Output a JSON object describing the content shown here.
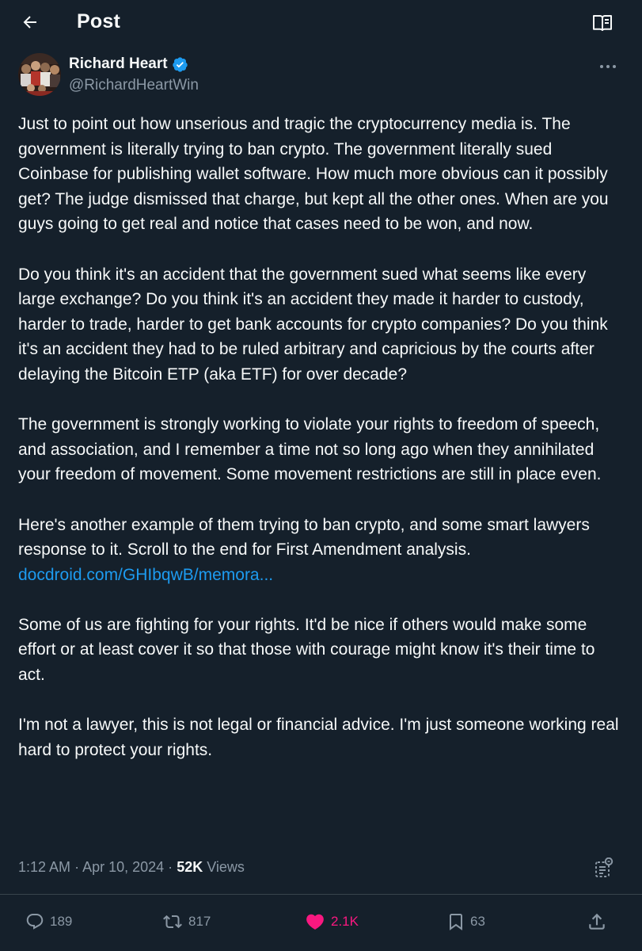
{
  "header": {
    "title": "Post"
  },
  "author": {
    "name": "Richard Heart",
    "handle": "@RichardHeartWin",
    "verified": true
  },
  "tweet": {
    "paragraphs": [
      "Just to point out how unserious and tragic the cryptocurrency media is. The government is literally trying to ban crypto. The government literally sued Coinbase for publishing wallet software. How much more obvious can it possibly get? The judge dismissed that charge, but kept all the other ones. When are you guys going to get real and notice that cases need to be won, and now.",
      "Do you think it's an accident that the government sued what seems like every large exchange? Do you think it's an accident they made it harder to custody, harder to trade, harder to get bank accounts for crypto companies? Do you think it's an accident they had to be ruled arbitrary and capricious by the courts after delaying the Bitcoin ETP (aka ETF) for over decade?",
      "The government is strongly working to violate your rights to freedom of speech, and association, and I remember a time not so long ago when they annihilated your freedom of movement. Some movement restrictions are still in place even.",
      "Here's another example of them trying to ban crypto, and some smart lawyers response to it. Scroll to the end for First Amendment analysis.",
      "Some of us are fighting for your rights. It'd be nice if others would make some effort or at least cover it so that those with courage might know it's their time to act.",
      "I'm not a lawyer, this is not legal or financial advice. I'm just someone working real hard to protect your rights."
    ],
    "link_text": "docdroid.com/GHIbqwB/memora..."
  },
  "meta": {
    "time": "1:12 AM",
    "separator": "·",
    "date": "Apr 10, 2024",
    "views_count": "52K",
    "views_label": "Views"
  },
  "actions": {
    "replies": "189",
    "reposts": "817",
    "likes": "2.1K",
    "bookmarks": "63"
  },
  "colors": {
    "background": "#15202b",
    "text": "#f7f9f9",
    "secondary": "#8b98a5",
    "link": "#1d9bf0",
    "like": "#f91880",
    "divider": "#38444d"
  },
  "icons": {
    "back": "arrow-left-icon",
    "reader": "open-book-icon",
    "verified": "verified-badge-icon",
    "more": "more-dots-icon",
    "grok": "grok-analyze-icon",
    "reply": "reply-icon",
    "repost": "repost-icon",
    "like": "heart-filled-icon",
    "bookmark": "bookmark-icon",
    "share": "share-icon"
  }
}
